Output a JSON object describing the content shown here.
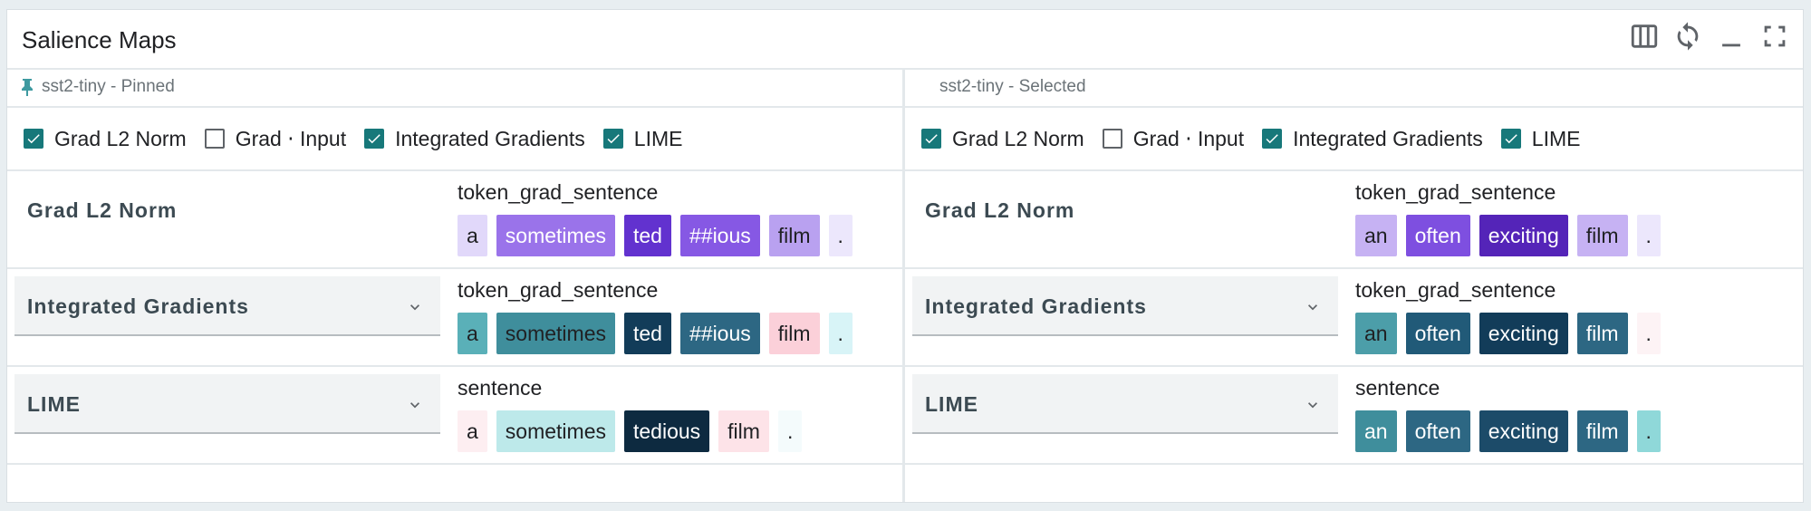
{
  "module": {
    "title": "Salience Maps",
    "icons": [
      "columns-icon",
      "sync-icon",
      "minimize-icon",
      "fullscreen-icon"
    ]
  },
  "colors": {
    "checkbox_on": "#17787a",
    "grad_palette": "purple",
    "ig_palette": "teal-to-navy",
    "lime_palette": "pink/teal diverging"
  },
  "panels": [
    {
      "label": "sst2-tiny - Pinned",
      "pinned": true,
      "methods": [
        {
          "label": "Grad L2 Norm",
          "checked": true
        },
        {
          "label": "Grad ⋅ Input",
          "checked": false
        },
        {
          "label": "Integrated Gradients",
          "checked": true
        },
        {
          "label": "LIME",
          "checked": true
        }
      ],
      "rows": [
        {
          "label": "Grad L2 Norm",
          "dropdown": false,
          "field": "token_grad_sentence",
          "tokens": [
            {
              "text": "a",
              "bg": "#e1d8fa",
              "fg": "#202124"
            },
            {
              "text": "sometimes",
              "bg": "#9a73ea",
              "fg": "#ffffff"
            },
            {
              "text": "ted",
              "bg": "#6232cf",
              "fg": "#ffffff"
            },
            {
              "text": "##ious",
              "bg": "#8658e4",
              "fg": "#ffffff"
            },
            {
              "text": "film",
              "bg": "#b9a1f0",
              "fg": "#202124"
            },
            {
              "text": ".",
              "bg": "#ece7fc",
              "fg": "#202124"
            }
          ]
        },
        {
          "label": "Integrated Gradients",
          "dropdown": true,
          "field": "token_grad_sentence",
          "tokens": [
            {
              "text": "a",
              "bg": "#5ab0b8",
              "fg": "#202124"
            },
            {
              "text": "sometimes",
              "bg": "#3f8e9c",
              "fg": "#202124"
            },
            {
              "text": "ted",
              "bg": "#123c59",
              "fg": "#ffffff"
            },
            {
              "text": "##ious",
              "bg": "#2d6783",
              "fg": "#ffffff"
            },
            {
              "text": "film",
              "bg": "#fbd0d9",
              "fg": "#202124"
            },
            {
              "text": ".",
              "bg": "#d8f4f7",
              "fg": "#202124"
            }
          ]
        },
        {
          "label": "LIME",
          "dropdown": true,
          "field": "sentence",
          "tokens": [
            {
              "text": "a",
              "bg": "#fdeef1",
              "fg": "#202124"
            },
            {
              "text": "sometimes",
              "bg": "#bde9ea",
              "fg": "#202124"
            },
            {
              "text": "tedious",
              "bg": "#0d2a40",
              "fg": "#ffffff"
            },
            {
              "text": "film",
              "bg": "#fde3e8",
              "fg": "#202124"
            },
            {
              "text": ".",
              "bg": "#f4fbfc",
              "fg": "#202124"
            }
          ]
        }
      ]
    },
    {
      "label": "sst2-tiny - Selected",
      "pinned": false,
      "methods": [
        {
          "label": "Grad L2 Norm",
          "checked": true
        },
        {
          "label": "Grad ⋅ Input",
          "checked": false
        },
        {
          "label": "Integrated Gradients",
          "checked": true
        },
        {
          "label": "LIME",
          "checked": true
        }
      ],
      "rows": [
        {
          "label": "Grad L2 Norm",
          "dropdown": false,
          "field": "token_grad_sentence",
          "tokens": [
            {
              "text": "an",
              "bg": "#c6b2f3",
              "fg": "#202124"
            },
            {
              "text": "often",
              "bg": "#7e4fe0",
              "fg": "#ffffff"
            },
            {
              "text": "exciting",
              "bg": "#5424b8",
              "fg": "#ffffff"
            },
            {
              "text": "film",
              "bg": "#c6b2f3",
              "fg": "#202124"
            },
            {
              "text": ".",
              "bg": "#ece7fc",
              "fg": "#202124"
            }
          ]
        },
        {
          "label": "Integrated Gradients",
          "dropdown": true,
          "field": "token_grad_sentence",
          "tokens": [
            {
              "text": "an",
              "bg": "#4c9ea9",
              "fg": "#202124"
            },
            {
              "text": "often",
              "bg": "#215a78",
              "fg": "#ffffff"
            },
            {
              "text": "exciting",
              "bg": "#123c59",
              "fg": "#ffffff"
            },
            {
              "text": "film",
              "bg": "#2d6783",
              "fg": "#ffffff"
            },
            {
              "text": ".",
              "bg": "#fdf3f5",
              "fg": "#202124"
            }
          ]
        },
        {
          "label": "LIME",
          "dropdown": true,
          "field": "sentence",
          "tokens": [
            {
              "text": "an",
              "bg": "#3f8e9c",
              "fg": "#ffffff"
            },
            {
              "text": "often",
              "bg": "#2d6783",
              "fg": "#ffffff"
            },
            {
              "text": "exciting",
              "bg": "#1c4b69",
              "fg": "#ffffff"
            },
            {
              "text": "film",
              "bg": "#2d6783",
              "fg": "#ffffff"
            },
            {
              "text": ".",
              "bg": "#8fd8d9",
              "fg": "#202124"
            }
          ]
        }
      ]
    }
  ]
}
